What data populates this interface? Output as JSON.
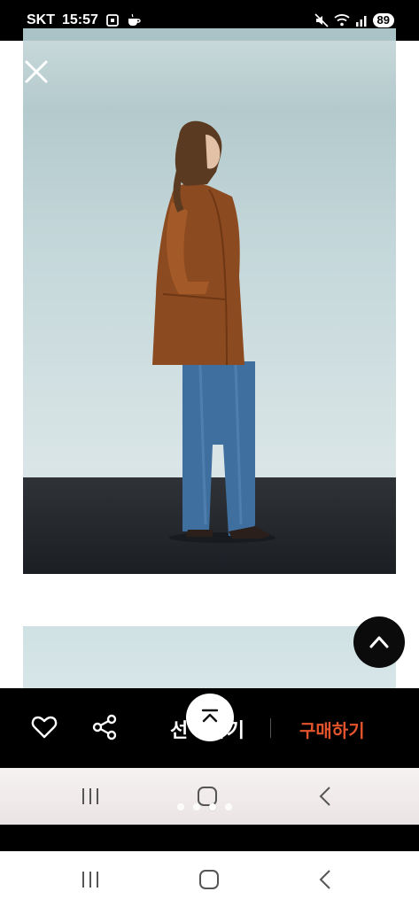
{
  "status_bar": {
    "carrier": "SKT",
    "time": "15:57",
    "battery": "89",
    "icons": [
      "screenshot-icon",
      "coffee-icon",
      "mute-icon",
      "wifi-icon",
      "signal-icon"
    ]
  },
  "viewer": {
    "close_icon": "close-icon",
    "scroll_top_icon": "chevron-up-icon"
  },
  "action_bar": {
    "like_icon": "heart-icon",
    "share_icon": "share-icon",
    "select_label": "선택하기",
    "buy_label": "구매하기",
    "buy_color": "#e3542c",
    "collapse_icon": "collapse-up-icon"
  },
  "pager": {
    "count": 4,
    "active_index": 2
  },
  "nav": {
    "recents_icon": "recents-icon",
    "home_icon": "home-icon",
    "back_icon": "back-icon"
  }
}
